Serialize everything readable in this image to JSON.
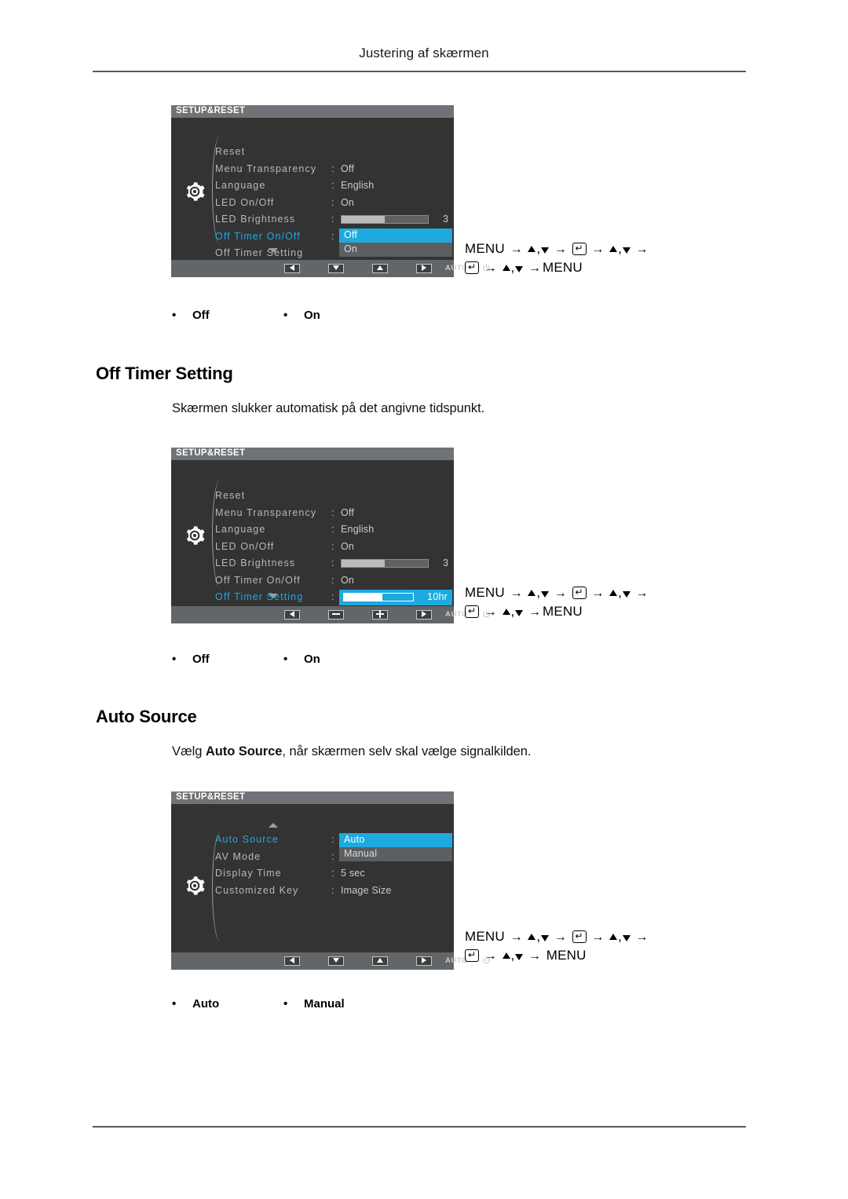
{
  "page": {
    "header_title": "Justering af skærmen"
  },
  "nav_legend": {
    "menu_word": "MENU",
    "enter_glyph": "↵",
    "arrow": "→",
    "comma": ",",
    "sequence_1": "MENU → ▲ , ▼ → ↵ → ▲ , ▼ → ↵ → ▲ , ▼ →MENU",
    "sequence_2": "MENU → ▲ , ▼ → ↵ → ▲ , ▼ → ↵ → ▲ , ▼ →MENU",
    "sequence_3": "MENU → ▲ , ▼ → ↵ → ▲ , ▼ → ↵ → ▲ , ▼ → MENU"
  },
  "osd_common": {
    "title": "SETUP&RESET",
    "gear_icon": "gear-icon",
    "keybar": {
      "auto_label": "AUTO",
      "power_icon": "power-icon"
    }
  },
  "section_off_timer_onoff": {
    "osd": {
      "title": "SETUP&RESET",
      "rows": [
        {
          "label": "Reset",
          "colon": "",
          "value": ""
        },
        {
          "label": "Menu Transparency",
          "colon": ":",
          "value": "Off"
        },
        {
          "label": "Language",
          "colon": ":",
          "value": "English"
        },
        {
          "label": "LED On/Off",
          "colon": ":",
          "value": "On"
        },
        {
          "label": "LED Brightness",
          "colon": ":",
          "value": "",
          "slider_percent": 50,
          "slider_number": "3"
        },
        {
          "label": "Off Timer On/Off",
          "colon": ":",
          "value": "",
          "selected": true
        },
        {
          "label": "Off Timer Setting",
          "colon": "",
          "value": ""
        }
      ],
      "dropdown": {
        "options": [
          "Off",
          "On"
        ],
        "selected": "Off"
      },
      "scroll_down_indicator": "chevron-down-icon"
    },
    "bullets": [
      "Off",
      "On"
    ]
  },
  "section_off_timer_setting": {
    "heading": "Off Timer Setting",
    "description": "Skærmen slukker automatisk på det angivne tidspunkt.",
    "osd": {
      "title": "SETUP&RESET",
      "rows": [
        {
          "label": "Reset",
          "colon": "",
          "value": ""
        },
        {
          "label": "Menu Transparency",
          "colon": ":",
          "value": "Off"
        },
        {
          "label": "Language",
          "colon": ":",
          "value": "English"
        },
        {
          "label": "LED On/Off",
          "colon": ":",
          "value": "On"
        },
        {
          "label": "LED Brightness",
          "colon": ":",
          "value": "",
          "slider_percent": 50,
          "slider_number": "3"
        },
        {
          "label": "Off Timer On/Off",
          "colon": ":",
          "value": "On"
        },
        {
          "label": "Off Timer Setting",
          "colon": ":",
          "value": "",
          "selected": true,
          "hl_slider_percent": 56,
          "hl_slider_text": "10hr"
        }
      ],
      "scroll_down_indicator": "chevron-down-icon"
    },
    "bullets": [
      "Off",
      "On"
    ]
  },
  "section_auto_source": {
    "heading": "Auto Source",
    "description_pre": "Vælg ",
    "description_bold": "Auto Source",
    "description_post": ", når skærmen selv skal vælge signalkilden.",
    "osd": {
      "title": "SETUP&RESET",
      "rows": [
        {
          "label": "Auto Source",
          "colon": ":",
          "value": "",
          "selected": true
        },
        {
          "label": "AV Mode",
          "colon": ":",
          "value": ""
        },
        {
          "label": "Display Time",
          "colon": ":",
          "value": "5 sec"
        },
        {
          "label": "Customized Key",
          "colon": ":",
          "value": "Image Size"
        }
      ],
      "dropdown": {
        "options": [
          "Auto",
          "Manual"
        ],
        "selected": "Auto"
      },
      "scroll_up_indicator": "chevron-up-icon"
    },
    "bullets": [
      "Auto",
      "Manual"
    ]
  },
  "colors": {
    "osd_background": "#333333",
    "osd_titlebar": "#6f7276",
    "osd_text": "#b6b9bb",
    "accent_cyan": "#1eaadf",
    "selected_label": "#23a8dd",
    "keybar": "#636668",
    "rule": "#555a5e"
  }
}
